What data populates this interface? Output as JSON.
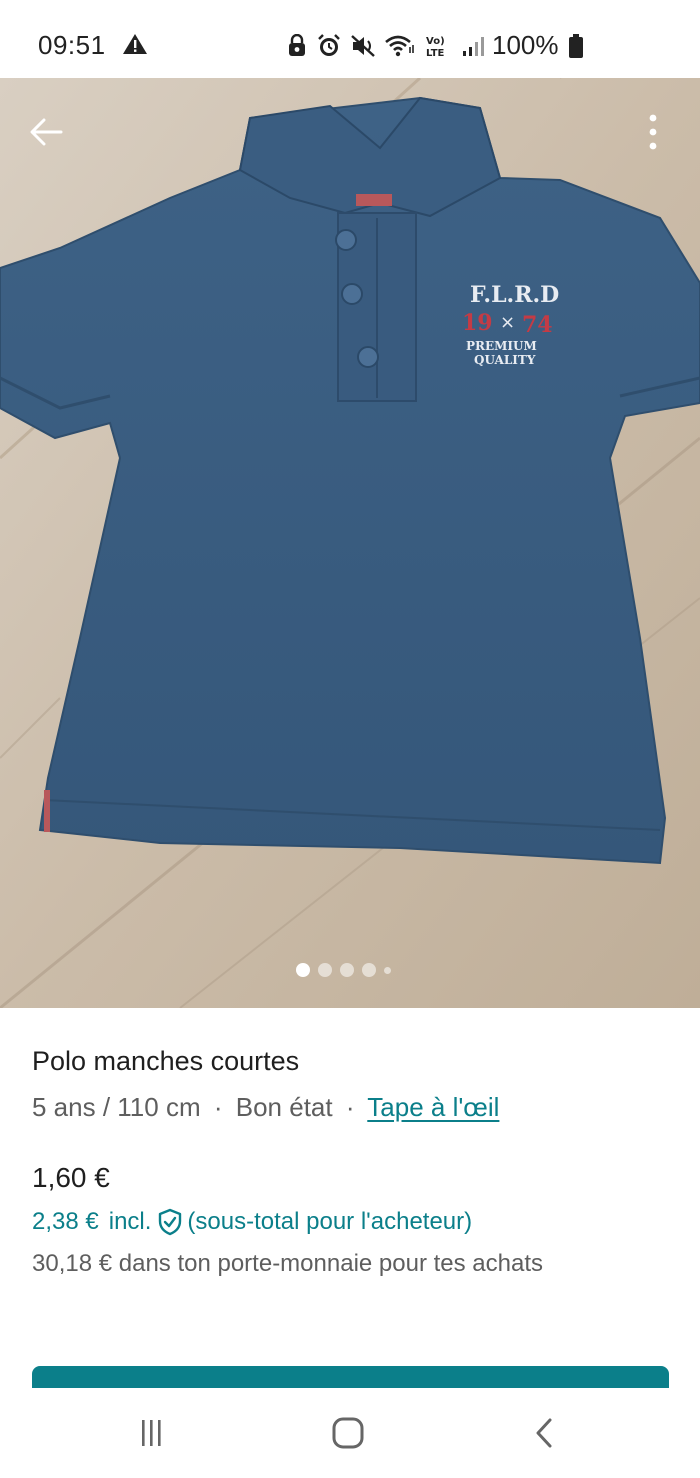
{
  "status_bar": {
    "time": "09:51",
    "battery": "100%",
    "icons": [
      "warning-icon",
      "alarm-lock-icon",
      "alarm-icon",
      "mute-icon",
      "wifi-icon",
      "volte-icon",
      "signal-icon",
      "battery-icon"
    ]
  },
  "gallery": {
    "image_description_icon": "photo",
    "dots_count": 5,
    "active_index": 0
  },
  "item": {
    "title": "Polo manches courtes",
    "size": "5 ans / 110 cm",
    "separator": "·",
    "condition": "Bon état",
    "brand": "Tape à l'œil"
  },
  "pricing": {
    "price": "1,60 €",
    "total_price": "2,38 €",
    "incl_label": "incl.",
    "total_note": "(sous-total pour l'acheteur)",
    "wallet_note": "30,18 € dans ton porte-monnaie pour tes achats"
  },
  "colors": {
    "accent": "#0b7f8a",
    "text_primary": "#1f1f1f",
    "text_secondary": "#5e5e5e",
    "shirt": "#3b5c7e"
  },
  "nav": {
    "icons": [
      "recent-apps-icon",
      "home-icon",
      "back-nav-icon"
    ]
  }
}
